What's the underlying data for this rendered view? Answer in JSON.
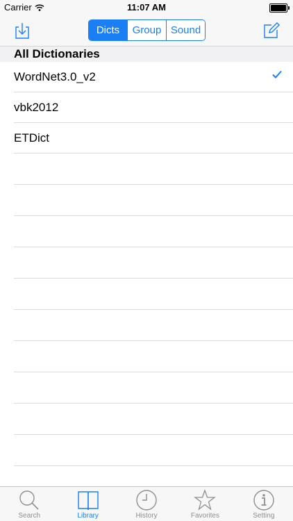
{
  "status_bar": {
    "carrier": "Carrier",
    "time": "11:07 AM"
  },
  "nav": {
    "left_icon": "download-tray-icon",
    "right_icon": "compose-icon",
    "segments": [
      {
        "label": "Dicts",
        "active": true
      },
      {
        "label": "Group",
        "active": false
      },
      {
        "label": "Sound",
        "active": false
      }
    ]
  },
  "section": {
    "title": "All Dictionaries"
  },
  "dictionaries": [
    {
      "name": "WordNet3.0_v2",
      "checked": true
    },
    {
      "name": "vbk2012",
      "checked": false
    },
    {
      "name": "ETDict",
      "checked": false
    }
  ],
  "tabs": [
    {
      "label": "Search",
      "icon": "search-icon",
      "active": false
    },
    {
      "label": "Library",
      "icon": "book-icon",
      "active": true
    },
    {
      "label": "History",
      "icon": "clock-icon",
      "active": false
    },
    {
      "label": "Favorites",
      "icon": "star-icon",
      "active": false
    },
    {
      "label": "Setting",
      "icon": "info-icon",
      "active": false
    }
  ],
  "colors": {
    "accent": "#1a7ef5",
    "inactive": "#8e8e93"
  }
}
